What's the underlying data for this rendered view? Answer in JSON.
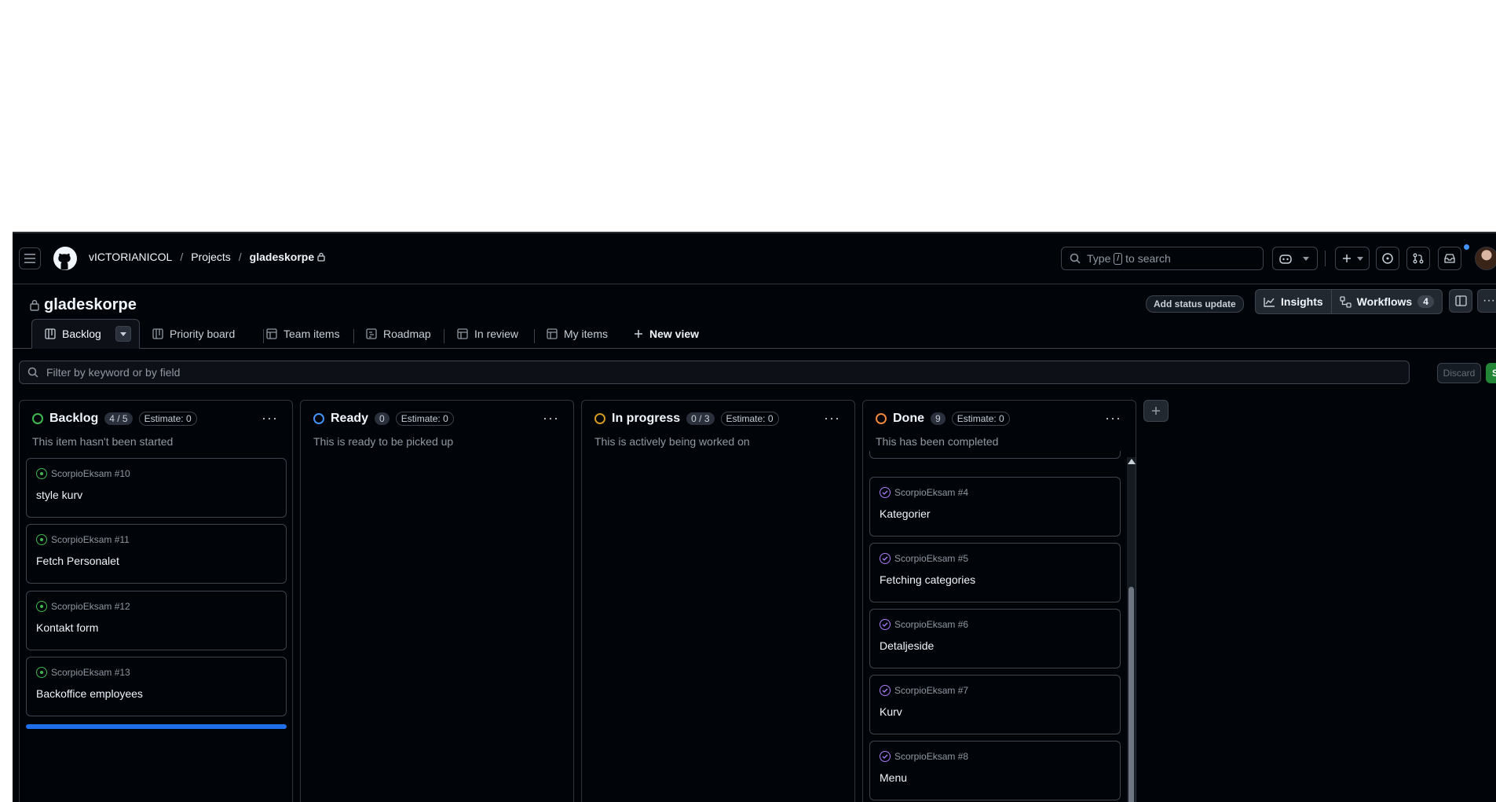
{
  "breadcrumb": {
    "owner": "vICTORIANICOL",
    "projects": "Projects",
    "project": "gladeskorpe",
    "sep": "/"
  },
  "search": {
    "prefix": "Type",
    "key": "/",
    "suffix": "to search"
  },
  "project": {
    "title": "gladeskorpe"
  },
  "actions": {
    "status_update": "Add status update",
    "insights": "Insights",
    "workflows": "Workflows",
    "workflows_count": "4"
  },
  "tabs": [
    {
      "label": "Backlog"
    },
    {
      "label": "Priority board"
    },
    {
      "label": "Team items"
    },
    {
      "label": "Roadmap"
    },
    {
      "label": "In review"
    },
    {
      "label": "My items"
    },
    {
      "label": "New view"
    }
  ],
  "filter": {
    "placeholder": "Filter by keyword or by field",
    "discard": "Discard",
    "save": "Save"
  },
  "columns": [
    {
      "name": "Backlog",
      "count": "4 / 5",
      "estimate": "Estimate: 0",
      "description": "This item hasn't been started",
      "color": "#3fb950",
      "cards": [
        {
          "meta": "ScorpioEksam #10",
          "title": "style kurv"
        },
        {
          "meta": "ScorpioEksam #11",
          "title": "Fetch Personalet"
        },
        {
          "meta": "ScorpioEksam #12",
          "title": "Kontakt form"
        },
        {
          "meta": "ScorpioEksam #13",
          "title": "Backoffice employees"
        }
      ]
    },
    {
      "name": "Ready",
      "count": "0",
      "estimate": "Estimate: 0",
      "description": "This is ready to be picked up",
      "color": "#4493f8",
      "cards": []
    },
    {
      "name": "In progress",
      "count": "0 / 3",
      "estimate": "Estimate: 0",
      "description": "This is actively being worked on",
      "color": "#d29922",
      "cards": []
    },
    {
      "name": "Done",
      "count": "9",
      "estimate": "Estimate: 0",
      "description": "This has been completed",
      "color": "#f0883e",
      "cards": [
        {
          "meta": "ScorpioEksam #4",
          "title": "Kategorier"
        },
        {
          "meta": "ScorpioEksam #5",
          "title": "Fetching categories"
        },
        {
          "meta": "ScorpioEksam #6",
          "title": "Detaljeside"
        },
        {
          "meta": "ScorpioEksam #7",
          "title": "Kurv"
        },
        {
          "meta": "ScorpioEksam #8",
          "title": "Menu"
        }
      ]
    }
  ]
}
